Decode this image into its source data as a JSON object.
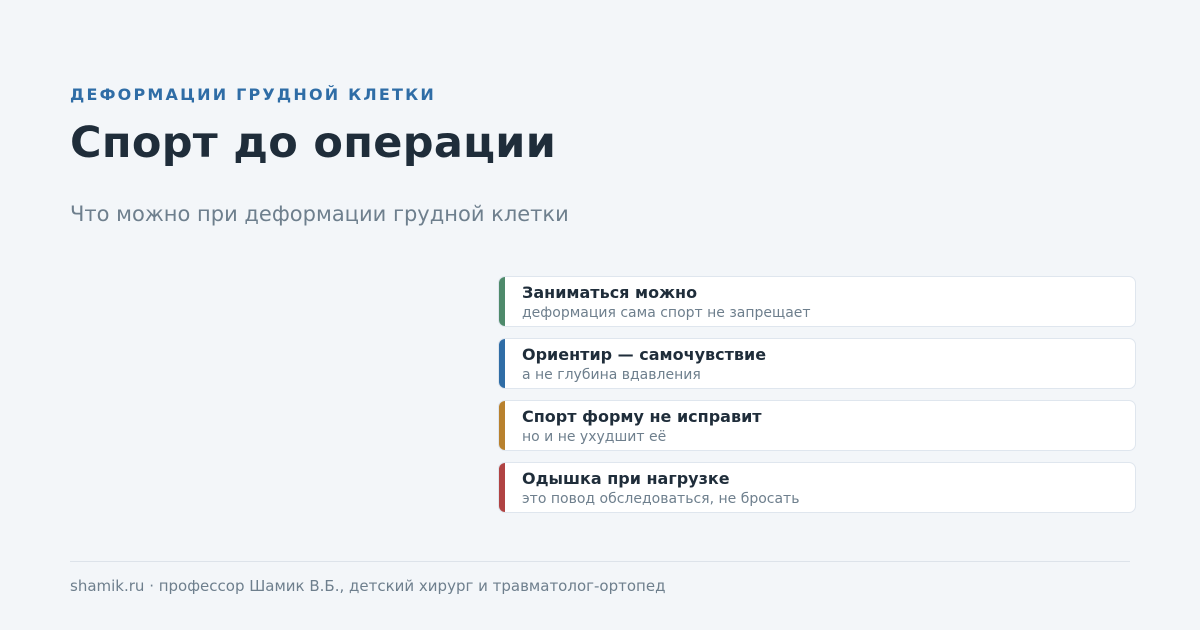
{
  "header": {
    "eyebrow": "ДЕФОРМАЦИИ ГРУДНОЙ КЛЕТКИ",
    "title": "Спорт до операции",
    "subtitle": "Что можно при деформации грудной клетки"
  },
  "cards": [
    {
      "title": "Заниматься можно",
      "text": "деформация сама спорт не запрещает",
      "accent_color": "#4e8a6b"
    },
    {
      "title": "Ориентир — самочувствие",
      "text": "а не глубина вдавления",
      "accent_color": "#2f6da6"
    },
    {
      "title": "Спорт форму не исправит",
      "text": "но и не ухудшит её",
      "accent_color": "#b8812e"
    },
    {
      "title": "Одышка при нагрузке",
      "text": "это повод обследоваться, не бросать",
      "accent_color": "#b04343"
    }
  ],
  "footer": {
    "text": "shamik.ru · профессор Шамик В.Б., детский хирург и травматолог-ортопед"
  },
  "colors": {
    "background": "#f3f6f9",
    "eyebrow": "#2f6da6",
    "title": "#1f2d3a",
    "muted_text": "#6e7f8d",
    "card_background": "#ffffff",
    "card_border": "#dfe6ee"
  }
}
